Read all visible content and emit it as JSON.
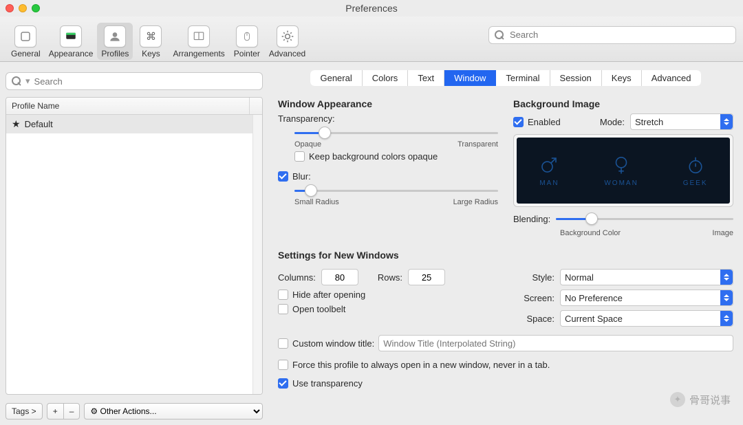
{
  "window": {
    "title": "Preferences"
  },
  "toolbar": {
    "items": [
      {
        "label": "General"
      },
      {
        "label": "Appearance"
      },
      {
        "label": "Profiles"
      },
      {
        "label": "Keys"
      },
      {
        "label": "Arrangements"
      },
      {
        "label": "Pointer"
      },
      {
        "label": "Advanced"
      }
    ],
    "search_placeholder": "Search"
  },
  "left": {
    "search_placeholder": "Search",
    "header": "Profile Name",
    "profiles": [
      {
        "name": "Default",
        "star": true
      }
    ],
    "tags_label": "Tags >",
    "plus": "+",
    "minus": "–",
    "other_actions": "⚙ Other Actions..."
  },
  "tabs": [
    "General",
    "Colors",
    "Text",
    "Window",
    "Terminal",
    "Session",
    "Keys",
    "Advanced"
  ],
  "active_tab": "Window",
  "panel": {
    "appearance_title": "Window Appearance",
    "transparency_label": "Transparency:",
    "transparency_left": "Opaque",
    "transparency_right": "Transparent",
    "transparency_value_pct": 15,
    "keep_opaque_label": "Keep background colors opaque",
    "keep_opaque_checked": false,
    "blur_label": "Blur:",
    "blur_checked": true,
    "blur_left": "Small Radius",
    "blur_right": "Large Radius",
    "blur_value_pct": 8,
    "bgimg_title": "Background Image",
    "bgimg_enabled_label": "Enabled",
    "bgimg_enabled": true,
    "mode_label": "Mode:",
    "mode_value": "Stretch",
    "blend_label": "Blending:",
    "blend_left": "Background Color",
    "blend_right": "Image",
    "blend_value_pct": 20,
    "preview_items": [
      "MAN",
      "WOMAN",
      "GEEK"
    ],
    "newwin_title": "Settings for New Windows",
    "columns_label": "Columns:",
    "columns_value": "80",
    "rows_label": "Rows:",
    "rows_value": "25",
    "hide_label": "Hide after opening",
    "hide_checked": false,
    "toolbelt_label": "Open toolbelt",
    "toolbelt_checked": false,
    "custom_title_label": "Custom window title:",
    "custom_title_checked": false,
    "custom_title_placeholder": "Window Title (Interpolated String)",
    "force_label": "Force this profile to always open in a new window, never in a tab.",
    "force_checked": false,
    "use_trans_label": "Use transparency",
    "use_trans_checked": true,
    "style_label": "Style:",
    "style_value": "Normal",
    "screen_label": "Screen:",
    "screen_value": "No Preference",
    "space_label": "Space:",
    "space_value": "Current Space"
  },
  "watermark": "骨哥说事"
}
